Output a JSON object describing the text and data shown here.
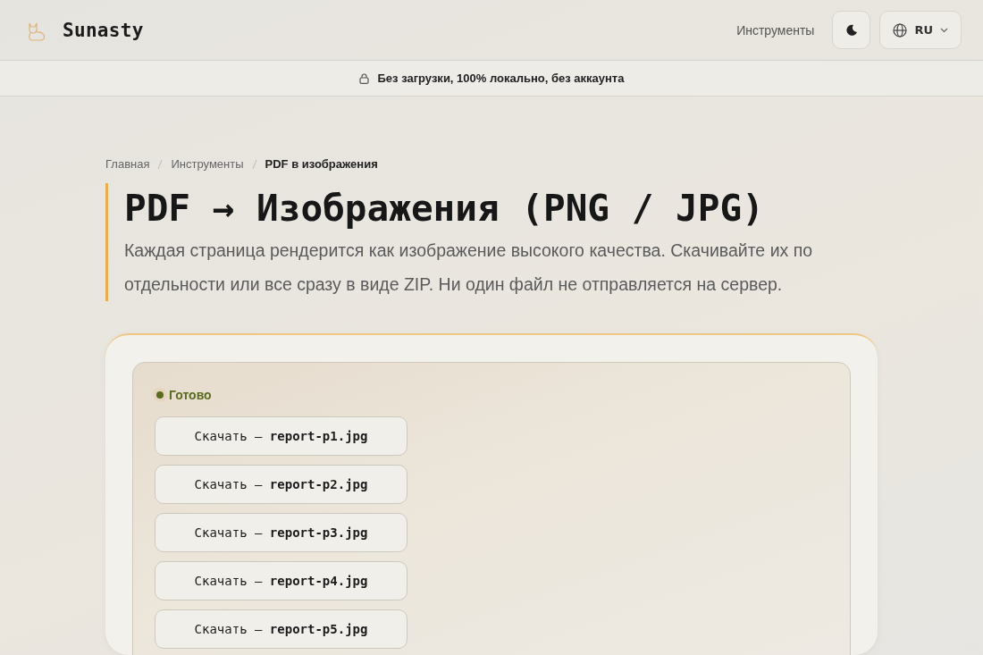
{
  "header": {
    "brand": "Sunasty",
    "nav_link": "Инструменты",
    "language": "RU"
  },
  "banner": "Без загрузки, 100% локально, без аккаунта",
  "breadcrumb": [
    {
      "label": "Главная",
      "current": false
    },
    {
      "label": "Инструменты",
      "current": false
    },
    {
      "label": "PDF в изображения",
      "current": true
    }
  ],
  "title": "PDF → Изображения (PNG / JPG)",
  "description": "Каждая страница рендерится как изображение высокого качества. Скачивайте их по отдельности или все сразу в виде ZIP. Ни один файл не отправляется на сервер.",
  "status": {
    "label": "Готово",
    "color": "#5a6b1f"
  },
  "downloads": [
    {
      "label": "Скачать — **report-p1.jpg**"
    },
    {
      "label": "Скачать — **report-p2.jpg**"
    },
    {
      "label": "Скачать — **report-p3.jpg**"
    },
    {
      "label": "Скачать — **report-p4.jpg**"
    },
    {
      "label": "Скачать — **report-p5.jpg**"
    }
  ]
}
